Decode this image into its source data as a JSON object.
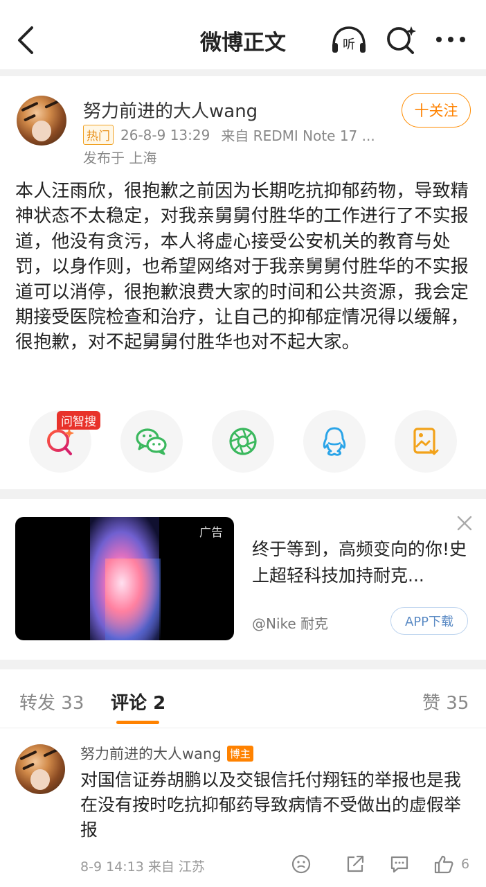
{
  "header": {
    "title": "微博正文",
    "listen_label": "听"
  },
  "post": {
    "username": "努力前进的大人wang",
    "hot_badge": "热门",
    "time": "26-8-9 13:29",
    "source": "来自 REDMI Note 17 ...",
    "location": "发布于 上海",
    "follow_label": "十关注",
    "body": "本人汪雨欣，很抱歉之前因为长期吃抗抑郁药物，导致精神状态不太稳定，对我亲舅舅付胜华的工作进行了不实报道，他没有贪污，本人将虚心接受公安机关的教育与处罚，以身作则，也希望网络对于我亲舅舅付胜华的不实报道可以消停，很抱歉浪费大家的时间和公共资源，我会定期接受医院检查和治疗，让自己的抑郁症情况得以缓解，很抱歉，对不起舅舅付胜华也对不起大家。"
  },
  "share": {
    "wenzhisou_tag": "问智搜",
    "icons": [
      "wenzhisou-icon",
      "wechat-icon",
      "moments-icon",
      "qq-icon",
      "save-image-icon"
    ]
  },
  "ad": {
    "label": "广告",
    "title": "终于等到，高频变向的你!史上超轻科技加持耐克...",
    "advertiser": "@Nike 耐克",
    "download_label": "APP下载"
  },
  "tabs": {
    "repost_label": "转发",
    "repost_count": "33",
    "comment_label": "评论",
    "comment_count": "2",
    "like_label": "赞",
    "like_count": "35"
  },
  "comment": {
    "username": "努力前进的大人wang",
    "badge": "博主",
    "text": "对国信证券胡鹏以及交银信托付翔钰的举报也是我在没有按时吃抗抑郁药导致病情不受做出的虚假举报",
    "meta": "8-9 14:13 来自 江苏",
    "like_count": "6"
  },
  "colors": {
    "accent": "#ff8200",
    "hot": "#e8901a",
    "wechat": "#3bb85e",
    "qq": "#2aa4e8",
    "save": "#f2a21a",
    "search_red": "#e8322a"
  }
}
